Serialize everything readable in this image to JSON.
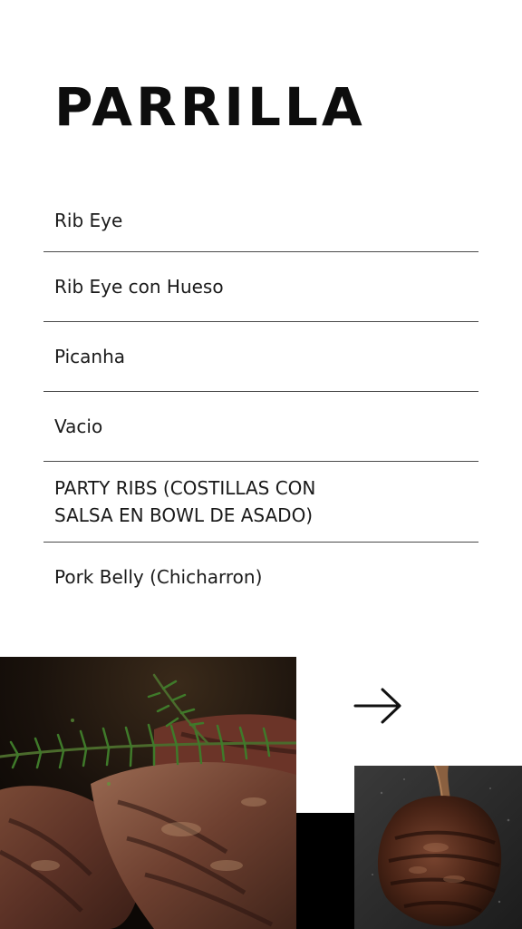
{
  "title": "PARRILLA",
  "menu": {
    "items": [
      {
        "lines": [
          "Rib Eye"
        ]
      },
      {
        "lines": [
          "Rib Eye con Hueso"
        ]
      },
      {
        "lines": [
          "Picanha"
        ]
      },
      {
        "lines": [
          "Vacio"
        ]
      },
      {
        "lines": [
          "PARTY RIBS (COSTILLAS CON",
          "SALSA EN BOWL DE ASADO)"
        ]
      },
      {
        "lines": [
          "Pork Belly (Chicharron)"
        ]
      }
    ]
  },
  "next_icon": "arrow-right-icon",
  "colors": {
    "background": "#ffffff",
    "text": "#111111",
    "divider": "#4a4a4a",
    "block": "#000000"
  }
}
